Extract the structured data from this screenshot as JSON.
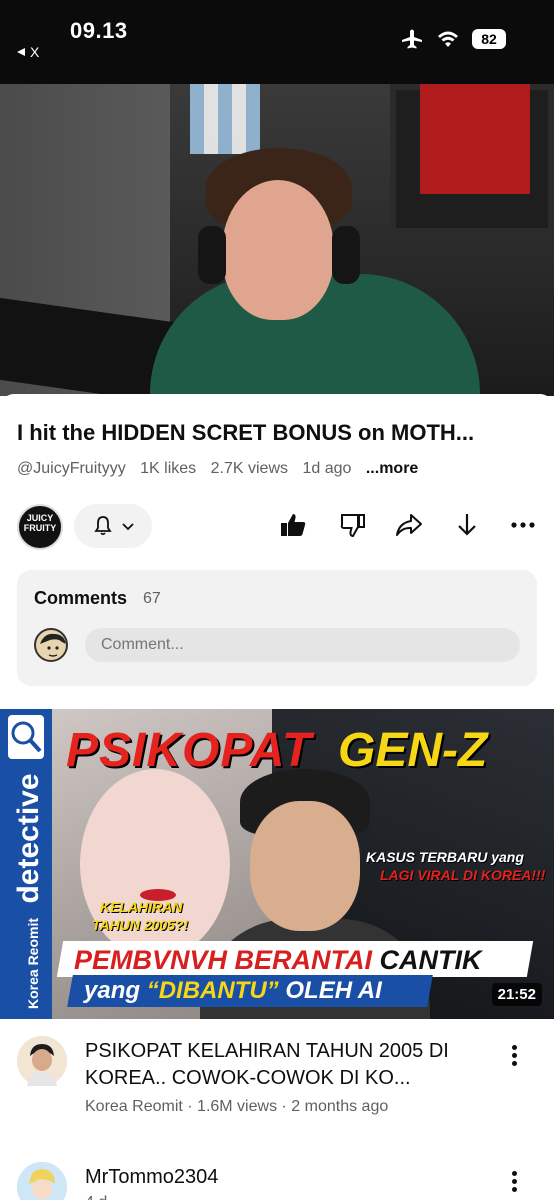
{
  "status_bar": {
    "time": "09.13",
    "back_label": "X",
    "battery": "82",
    "icons": [
      "airplane-icon",
      "wifi-icon",
      "battery-icon"
    ]
  },
  "player": {
    "progress_fraction": 0.07,
    "progress_color": "#ff0000"
  },
  "video": {
    "title": "I hit the HIDDEN SCRET BONUS on MOTH...",
    "channel": "@JuicyFruityyy",
    "likes": "1K likes",
    "views": "2.7K views",
    "age": "1d ago",
    "more_label": "...more",
    "channel_avatar_text": "JUICY FRUITY"
  },
  "actions": {
    "icons": [
      "bell-icon",
      "chevron-down-icon",
      "like-icon",
      "dislike-icon",
      "share-icon",
      "download-icon",
      "more-icon"
    ]
  },
  "comments": {
    "label": "Comments",
    "count": "67",
    "placeholder": "Comment..."
  },
  "thumbnail": {
    "side_brand_big": "detective",
    "side_brand_small": "Korea Reomit",
    "title_red": "PSIKOPAT",
    "title_yellow": "GEN-Z",
    "kasus_line1": "KASUS TERBARU yang",
    "kasus_line2": "LAGI VIRAL DI KOREA!!!",
    "kelahiran_line1": "KELAHIRAN",
    "kelahiran_line2": "TAHUN 2005?!",
    "banner1_red": "PEMBVNVH BERANTAI",
    "banner1_black": "CANTIK",
    "banner2_white": "yang",
    "banner2_yellow": "“DIBANTU”",
    "banner2_end": "OLEH AI",
    "duration": "21:52"
  },
  "feed": [
    {
      "title": "PSIKOPAT KELAHIRAN TAHUN 2005 DI KOREA.. COWOK-COWOK DI KO...",
      "meta": "Korea Reomit · 1.6M views · 2 months ago"
    },
    {
      "title": "MrTommo2304",
      "meta": "4 d"
    }
  ],
  "colors": {
    "accent_red": "#ff0000",
    "chip_bg": "#f2f2f2",
    "secondary_text": "#606060"
  }
}
